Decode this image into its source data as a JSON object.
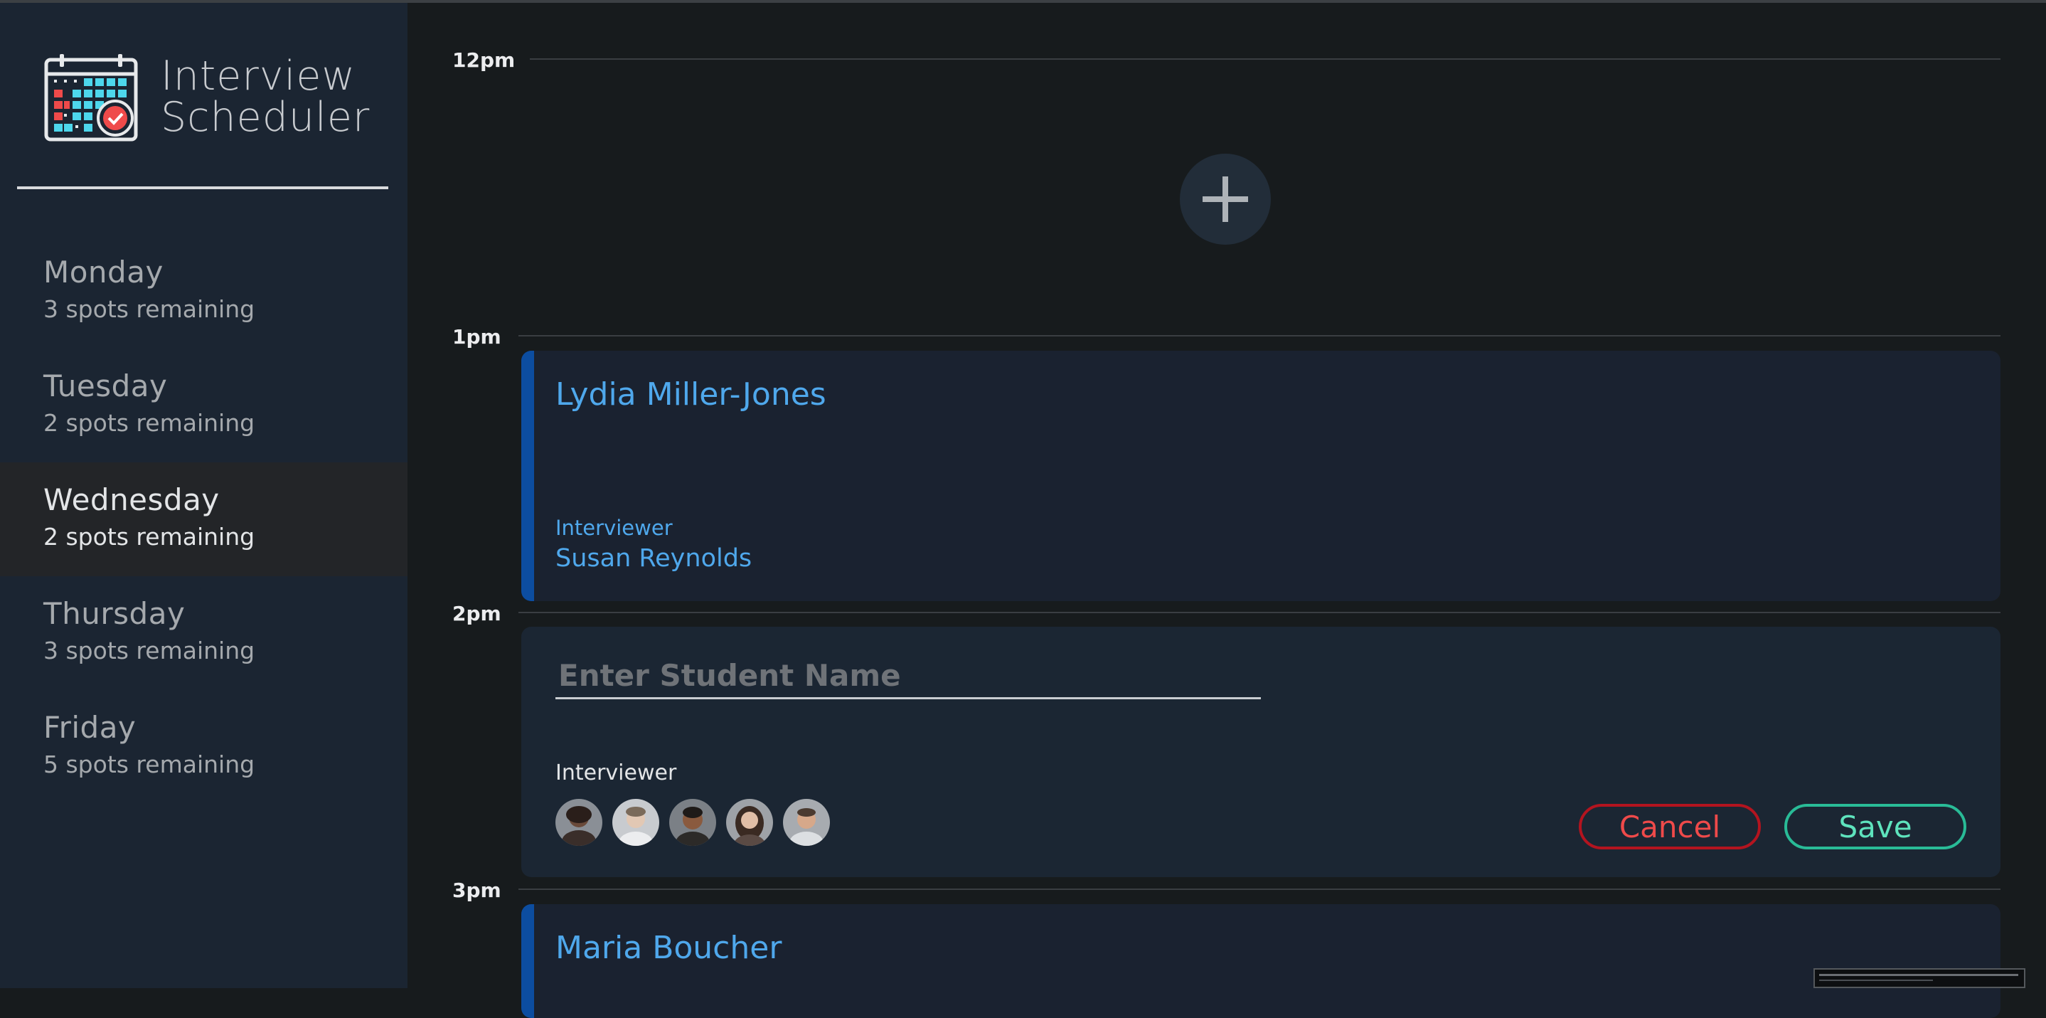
{
  "app": {
    "title_line1": "Interview",
    "title_line2": "Scheduler",
    "logo_icon": "calendar-check-icon"
  },
  "sidebar": {
    "days": [
      {
        "name": "Monday",
        "spots": "3 spots remaining",
        "selected": false
      },
      {
        "name": "Tuesday",
        "spots": "2 spots remaining",
        "selected": false
      },
      {
        "name": "Wednesday",
        "spots": "2 spots remaining",
        "selected": true
      },
      {
        "name": "Thursday",
        "spots": "3 spots remaining",
        "selected": false
      },
      {
        "name": "Friday",
        "spots": "5 spots remaining",
        "selected": false
      }
    ]
  },
  "schedule": {
    "times": [
      "12pm",
      "1pm",
      "2pm",
      "3pm"
    ],
    "empty_slot_icon": "plus-icon",
    "appointments": [
      {
        "student": "Lydia Miller-Jones",
        "interviewer_label": "Interviewer",
        "interviewer": "Susan Reynolds"
      },
      {
        "student": "Maria Boucher"
      }
    ],
    "form": {
      "student_placeholder": "Enter Student Name",
      "student_value": "",
      "interviewer_label": "Interviewer",
      "avatars": [
        "interviewer-avatar-1",
        "interviewer-avatar-2",
        "interviewer-avatar-3",
        "interviewer-avatar-4",
        "interviewer-avatar-5"
      ],
      "cancel_label": "Cancel",
      "save_label": "Save"
    }
  },
  "colors": {
    "sidebar_bg": "#1b2532",
    "main_bg": "#171b1d",
    "selected_day_bg": "#232528",
    "accent_blue": "#4fa8ec",
    "cancel_red": "#ef4a4a",
    "save_green": "#5ee3bd"
  }
}
